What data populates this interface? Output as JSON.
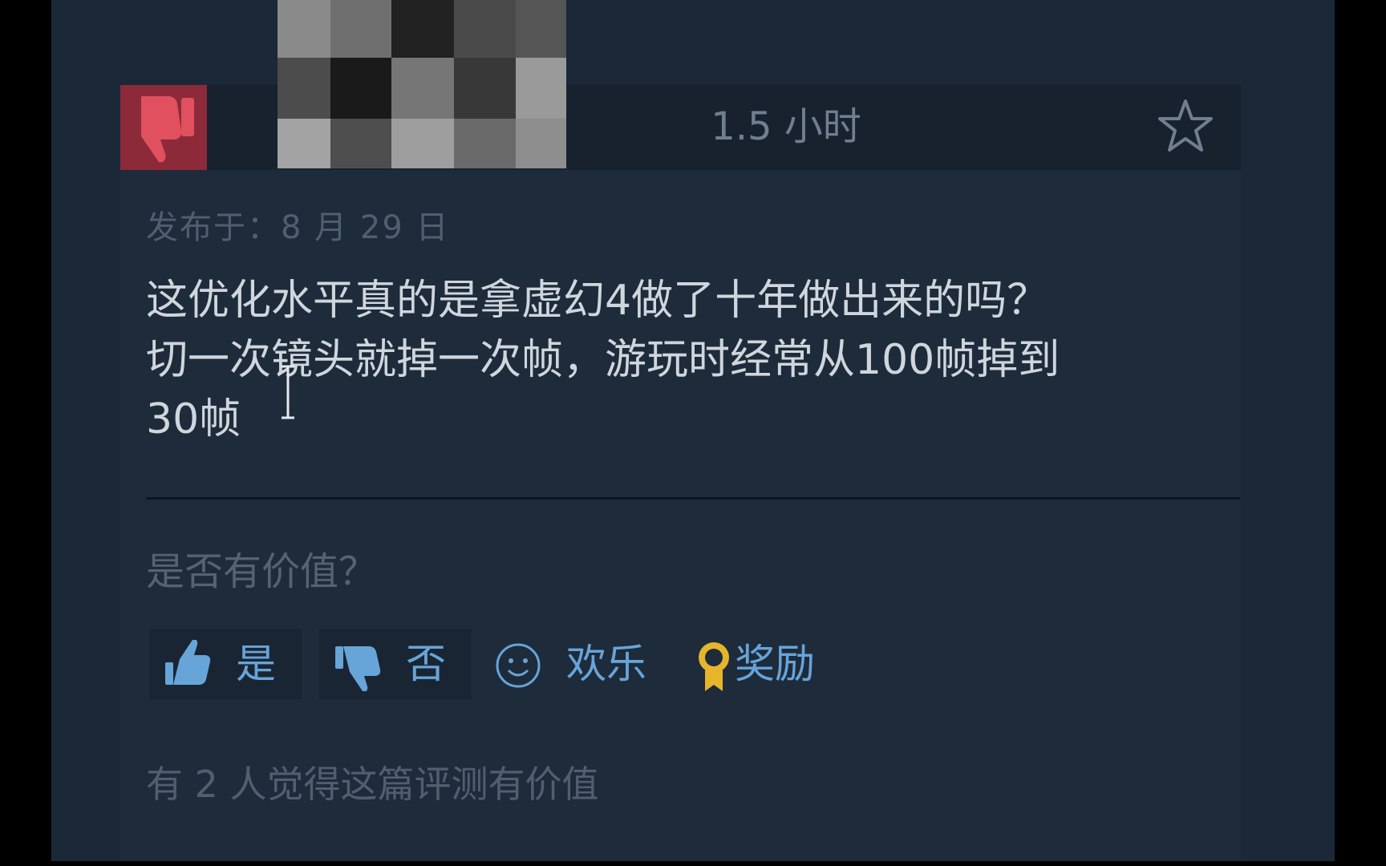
{
  "review": {
    "playtime": "1.5 小时",
    "posted": "发布于：8 月 29 日",
    "lines": [
      "这优化水平真的是拿虚幻4做了十年做出来的吗？",
      "切一次镜头就掉一次帧，游玩时经常从100帧掉到",
      "30帧"
    ],
    "helpful_question": "是否有价值？",
    "buttons": {
      "yes": "是",
      "no": "否",
      "funny": "欢乐",
      "award": "奖励"
    },
    "helpful_count": "有 2 人觉得这篇评测有价值"
  },
  "colors": {
    "background": "#1b2838",
    "thumb_down_box": "#8c2a3a",
    "thumb_down_icon": "#e0505f",
    "accent_blue": "#67a4d8",
    "award_gold": "#e5b52c"
  },
  "icons": {
    "vote": "thumbs-down-icon",
    "favorite": "star-icon",
    "yes": "thumbs-up-icon",
    "no": "thumbs-down-icon",
    "funny": "smiley-icon",
    "award": "award-ribbon-icon"
  }
}
